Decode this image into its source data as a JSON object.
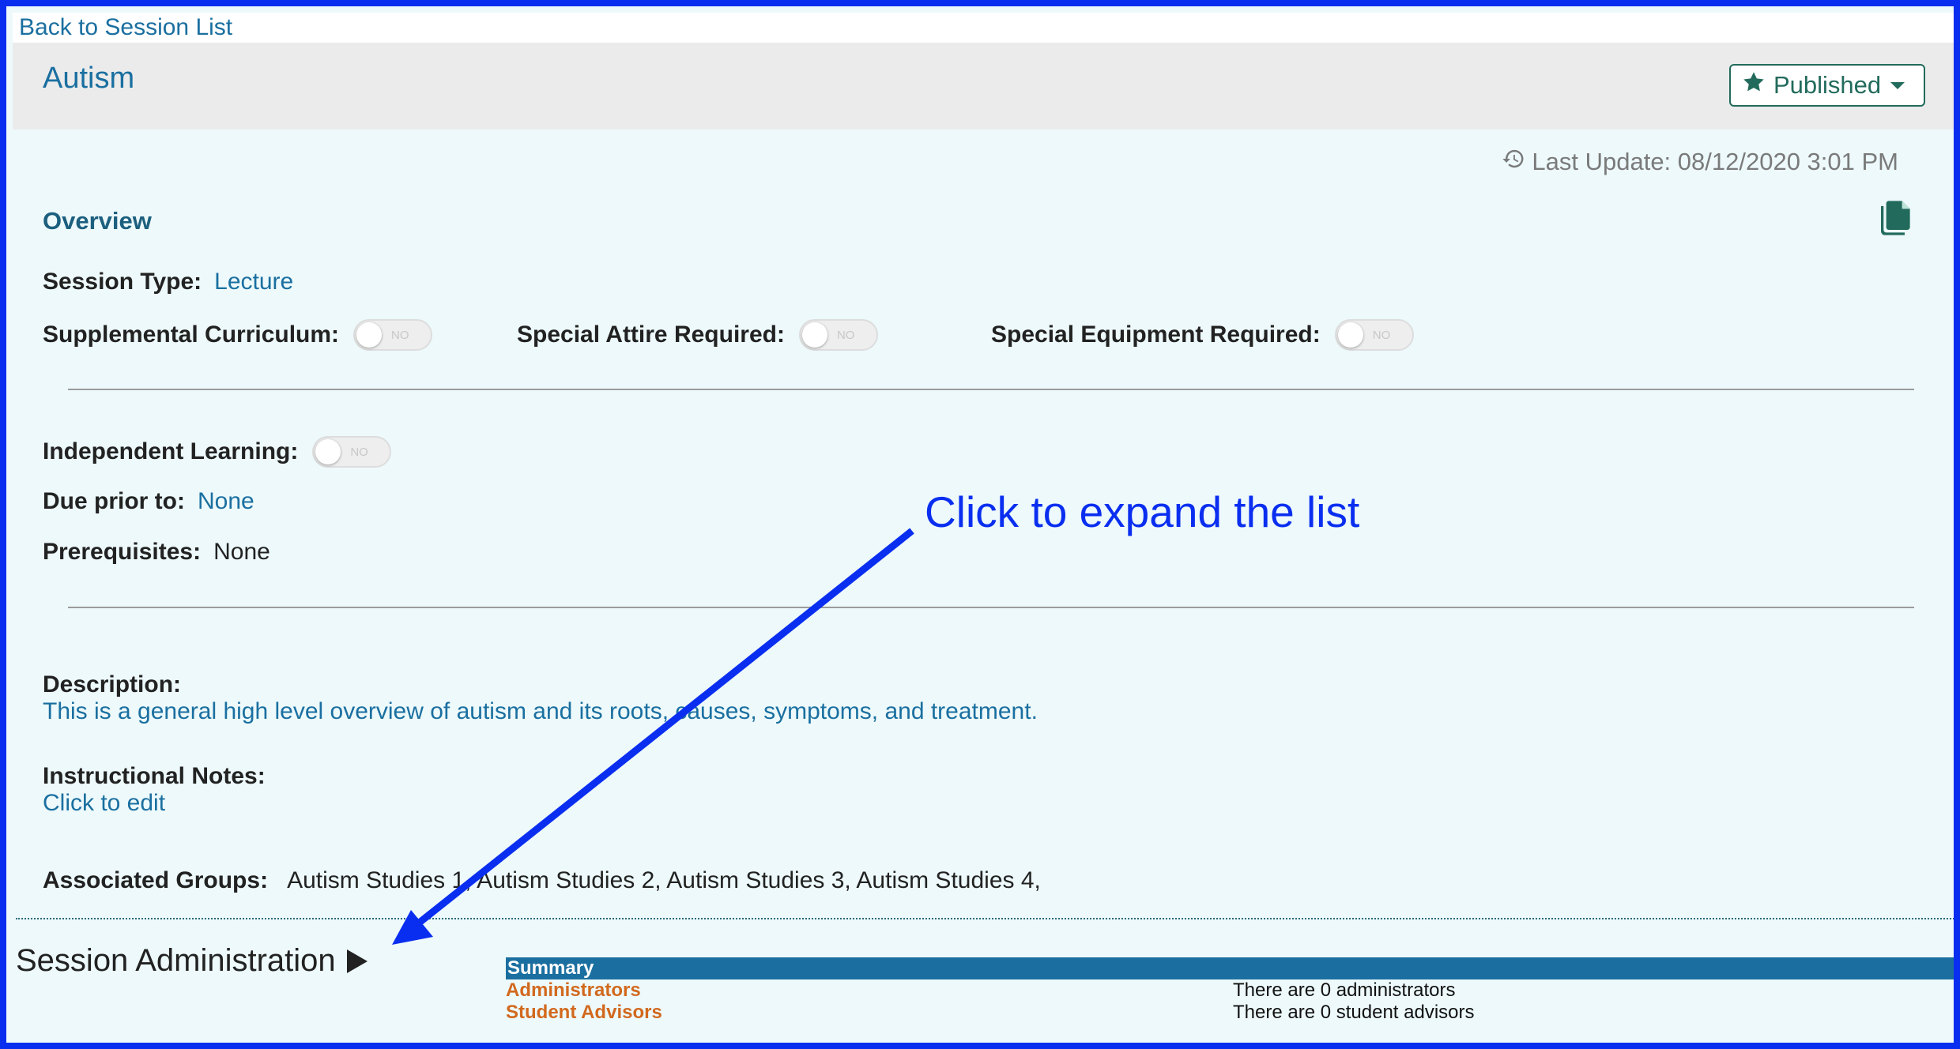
{
  "nav": {
    "back_label": "Back to Session List"
  },
  "header": {
    "title": "Autism",
    "status_label": "Published"
  },
  "last_update": "Last Update: 08/12/2020 3:01 PM",
  "overview": {
    "title": "Overview",
    "session_type_label": "Session Type:",
    "session_type_value": "Lecture",
    "supplemental_label": "Supplemental Curriculum:",
    "attire_label": "Special Attire Required:",
    "equipment_label": "Special Equipment Required:",
    "independent_label": "Independent Learning:",
    "toggle_text": "NO",
    "due_label": "Due prior to:",
    "due_value": "None",
    "prereq_label": "Prerequisites:",
    "prereq_value": "None",
    "description_label": "Description:",
    "description_value": "This is a general high level overview of autism and its roots, causes, symptoms, and treatment.",
    "notes_label": "Instructional Notes:",
    "notes_value": "Click to edit",
    "groups_label": "Associated Groups:",
    "groups_value": "Autism Studies 1, Autism Studies 2, Autism Studies 3, Autism Studies 4,"
  },
  "session_admin": {
    "title": "Session Administration",
    "summary_label": "Summary",
    "rows": [
      {
        "label": "Administrators",
        "value": "There are 0 administrators"
      },
      {
        "label": "Student Advisors",
        "value": "There are 0 student advisors"
      }
    ]
  },
  "annotation": {
    "text": "Click to expand the list",
    "color": "#0a2ef0"
  },
  "colors": {
    "link": "#1a6fa0",
    "brand_green": "#226b5c",
    "summary_bar": "#1b6fa0",
    "accent_orange": "#d2691e"
  },
  "icons": [
    "star-icon",
    "history-icon",
    "copy-icon",
    "caret-down-icon",
    "expand-triangle-icon"
  ]
}
